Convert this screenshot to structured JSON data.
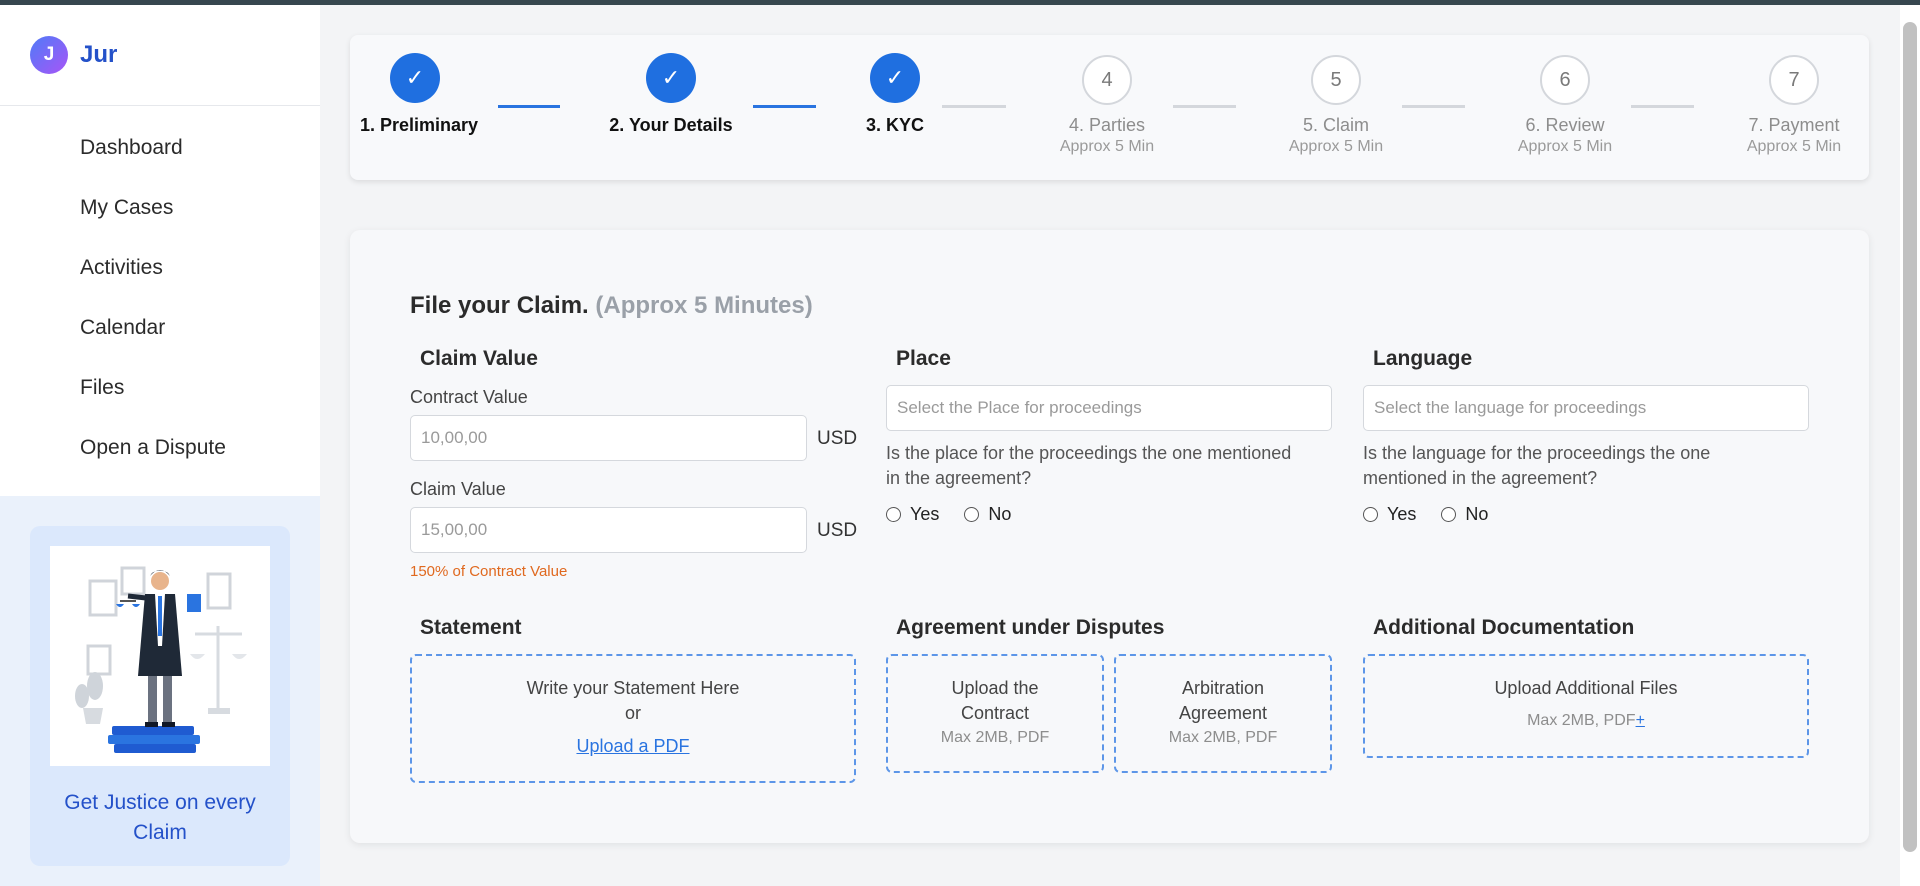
{
  "app": {
    "logo_letter": "J",
    "name": "Jur"
  },
  "sidebar": {
    "items": [
      {
        "label": "Dashboard"
      },
      {
        "label": "My Cases"
      },
      {
        "label": "Activities"
      },
      {
        "label": "Calendar"
      },
      {
        "label": "Files"
      },
      {
        "label": "Open a Dispute"
      }
    ],
    "promo_text": "Get Justice on every Claim"
  },
  "stepper": {
    "check": "✓",
    "steps": [
      {
        "number": "1",
        "label": "1. Preliminary",
        "status": "done"
      },
      {
        "number": "2",
        "label": "2. Your Details",
        "status": "done"
      },
      {
        "number": "3",
        "label": "3. KYC",
        "status": "done"
      },
      {
        "number": "4",
        "label": "4. Parties",
        "sub": "Approx 5 Min",
        "status": "pending"
      },
      {
        "number": "5",
        "label": "5. Claim",
        "sub": "Approx 5 Min",
        "status": "pending"
      },
      {
        "number": "6",
        "label": "6. Review",
        "sub": "Approx 5 Min",
        "status": "pending"
      },
      {
        "number": "7",
        "label": "7. Payment",
        "sub": "Approx 5 Min",
        "status": "pending"
      }
    ]
  },
  "form": {
    "title": "File your Claim.",
    "title_note": "(Approx 5 Minutes)",
    "claim_value": {
      "heading": "Claim Value",
      "contract_label": "Contract Value",
      "contract_placeholder": "10,00,00",
      "claim_label": "Claim Value",
      "claim_placeholder": "15,00,00",
      "currency": "USD",
      "hint": "150% of Contract Value"
    },
    "place": {
      "heading": "Place",
      "placeholder": "Select the Place for proceedings",
      "question": "Is the place for the proceedings the one mentioned in the agreement?",
      "yes": "Yes",
      "no": "No"
    },
    "language": {
      "heading": "Language",
      "placeholder": "Select the language for proceedings",
      "question": "Is the language for the proceedings the one mentioned in the agreement?",
      "yes": "Yes",
      "no": "No"
    },
    "statement": {
      "heading": "Statement",
      "line1": "Write your Statement Here",
      "line2": "or",
      "link": "Upload a PDF"
    },
    "agreement": {
      "heading": "Agreement under Disputes",
      "contract_line1": "Upload the",
      "contract_line2": "Contract",
      "arbitration_line1": "Arbitration",
      "arbitration_line2": "Agreement",
      "limits": "Max 2MB, PDF"
    },
    "additional": {
      "heading": "Additional Documentation",
      "line1": "Upload Additional Files",
      "limits": "Max 2MB, PDF",
      "plus": "+"
    }
  },
  "colors": {
    "accent": "#1f6fe0",
    "brand_text": "#2451c9",
    "hint": "#e0691f",
    "dashed_border": "#5d96e8"
  }
}
